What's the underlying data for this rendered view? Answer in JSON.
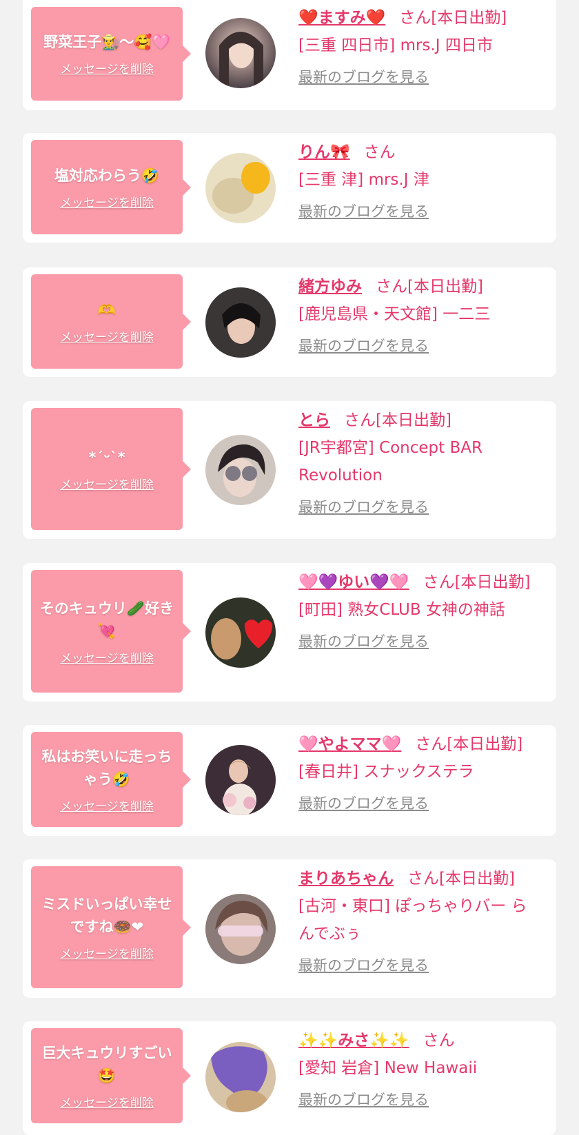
{
  "labels": {
    "delete": "メッセージを削除",
    "blog": "最新のブログを見る"
  },
  "colors": {
    "page_bg": "#f2f2f2",
    "bubble_bg": "#fb9aa8",
    "accent_pink": "#e5386a",
    "link_gray": "#8c8c8c"
  },
  "items": [
    {
      "message": "野菜王子👨‍🌾～🥰🩷",
      "name": "❤️ますみ❤️",
      "suffix": "さん[本日出勤]",
      "shop": "[三重 四日市] mrs.J 四日市",
      "avatar_icon": "avatar-photo"
    },
    {
      "message": "塩対応わらう🤣",
      "name": "りん🎀",
      "suffix": "さん",
      "shop": "[三重 津] mrs.J 津",
      "avatar_icon": "avatar-photo"
    },
    {
      "message": "🫶",
      "name": "緒方ゆみ",
      "suffix": "さん[本日出勤]",
      "shop": "[鹿児島県・天文館] 一二三",
      "avatar_icon": "avatar-photo"
    },
    {
      "message": "*´ᵕ`*",
      "name": "とら",
      "suffix": "さん[本日出勤]",
      "shop": "[JR宇都宮] Concept BAR Revolution",
      "avatar_icon": "avatar-photo"
    },
    {
      "message": "そのキュウリ🥒好き💘",
      "name": "🩷💜ゆい💜🩷",
      "suffix": "さん[本日出勤]",
      "shop": "[町田] 熟女CLUB 女神の神話",
      "avatar_icon": "avatar-photo"
    },
    {
      "message": "私はお笑いに走っちゃう🤣",
      "name": "🩷やよママ🩷",
      "suffix": "さん[本日出勤]",
      "shop": "[春日井] スナックステラ",
      "avatar_icon": "avatar-photo"
    },
    {
      "message": "ミスドいっぱい幸せですね🍩❤",
      "name": "まりあちゃん",
      "suffix": "さん[本日出勤]",
      "shop": "[古河・東口] ぽっちゃりバー らんでぶぅ",
      "avatar_icon": "avatar-photo"
    },
    {
      "message": "巨大キュウリすごい🤩",
      "name": "✨✨みさ✨✨",
      "suffix": "さん",
      "shop": "[愛知 岩倉] New Hawaii",
      "avatar_icon": "avatar-photo"
    }
  ]
}
